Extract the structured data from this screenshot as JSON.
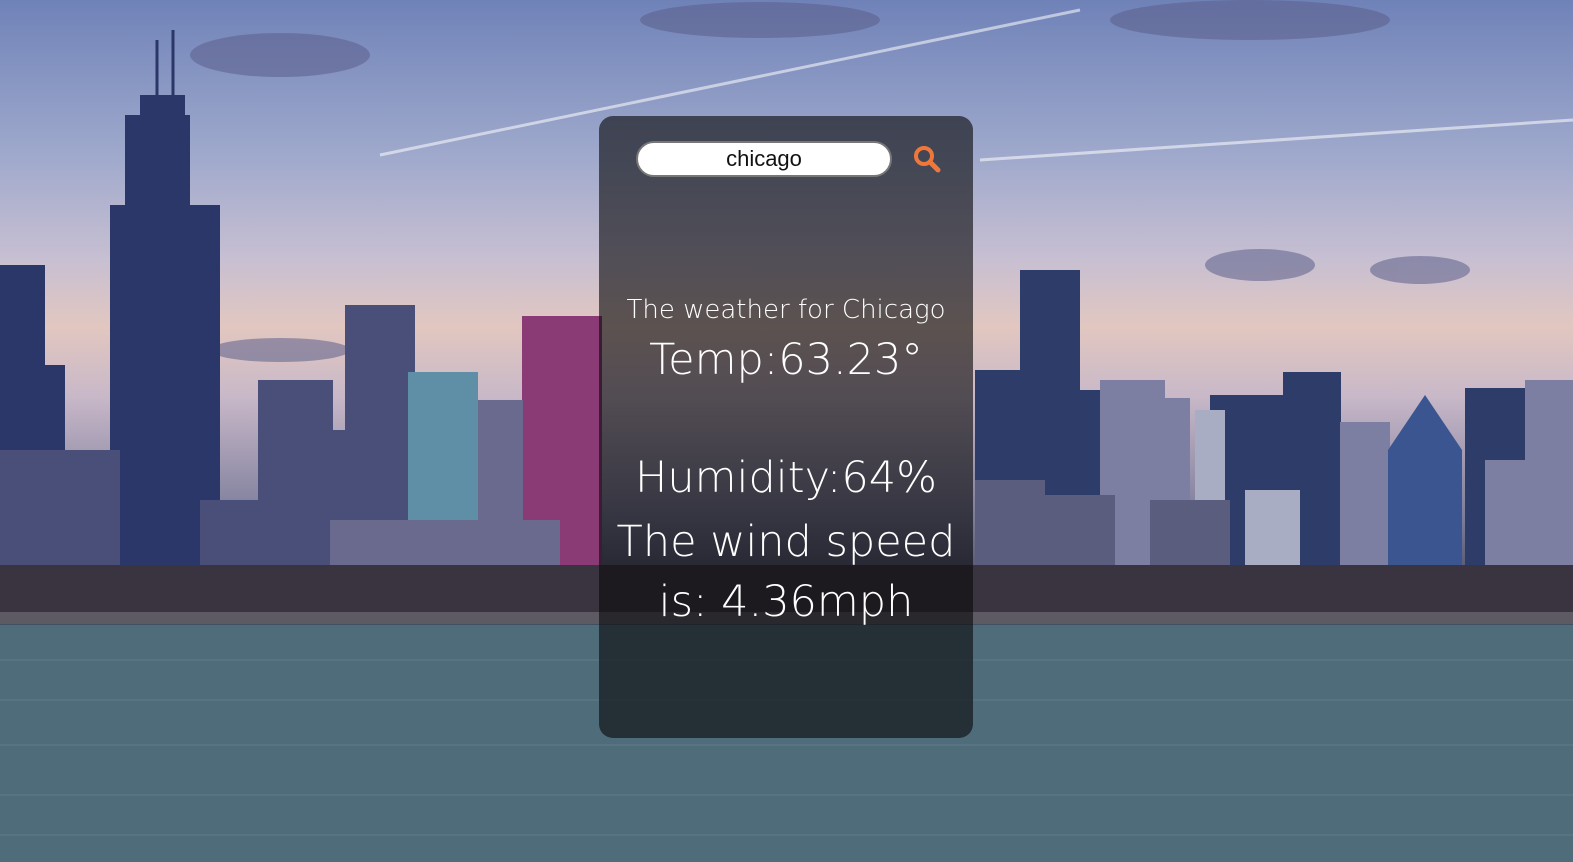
{
  "search": {
    "value": "chicago",
    "button_icon": "search-icon",
    "icon_color": "#f0773a"
  },
  "weather": {
    "city_heading": "The weather for Chicago",
    "temperature": "Temp:63.23°",
    "humidity": "Humidity:64%",
    "wind": "The wind speed is: 4.36mph"
  },
  "background": {
    "description_icon": "city-skyline-background"
  }
}
